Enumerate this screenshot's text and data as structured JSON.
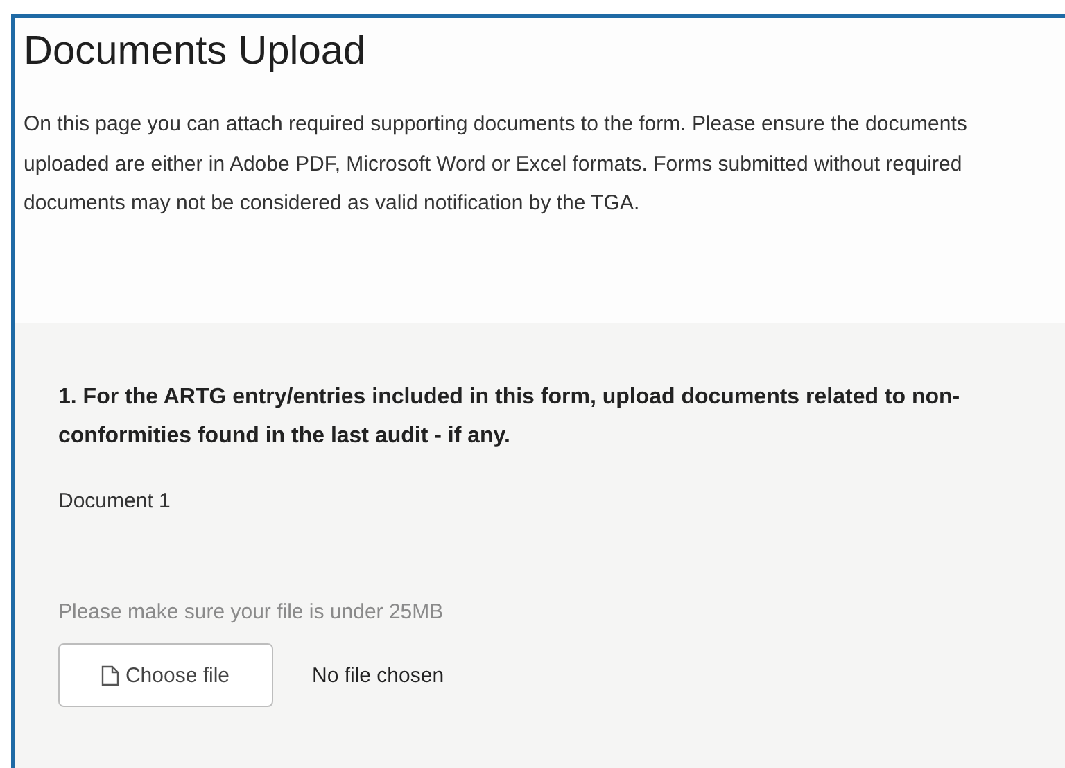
{
  "page": {
    "title": "Documents Upload",
    "intro": "On this page you can attach required supporting documents to the form. Please ensure the documents uploaded are either in Adobe PDF, Microsoft Word or Excel formats. Forms submitted without required documents may not be considered as valid notification by the TGA."
  },
  "questions": [
    {
      "label": "1. For the ARTG entry/entries included in this form, upload documents related to non-conformities found in the last audit - if any.",
      "document_label": "Document 1",
      "hint": "Please make sure your file is under 25MB",
      "button": "Choose file",
      "file_status": "No file chosen"
    }
  ]
}
